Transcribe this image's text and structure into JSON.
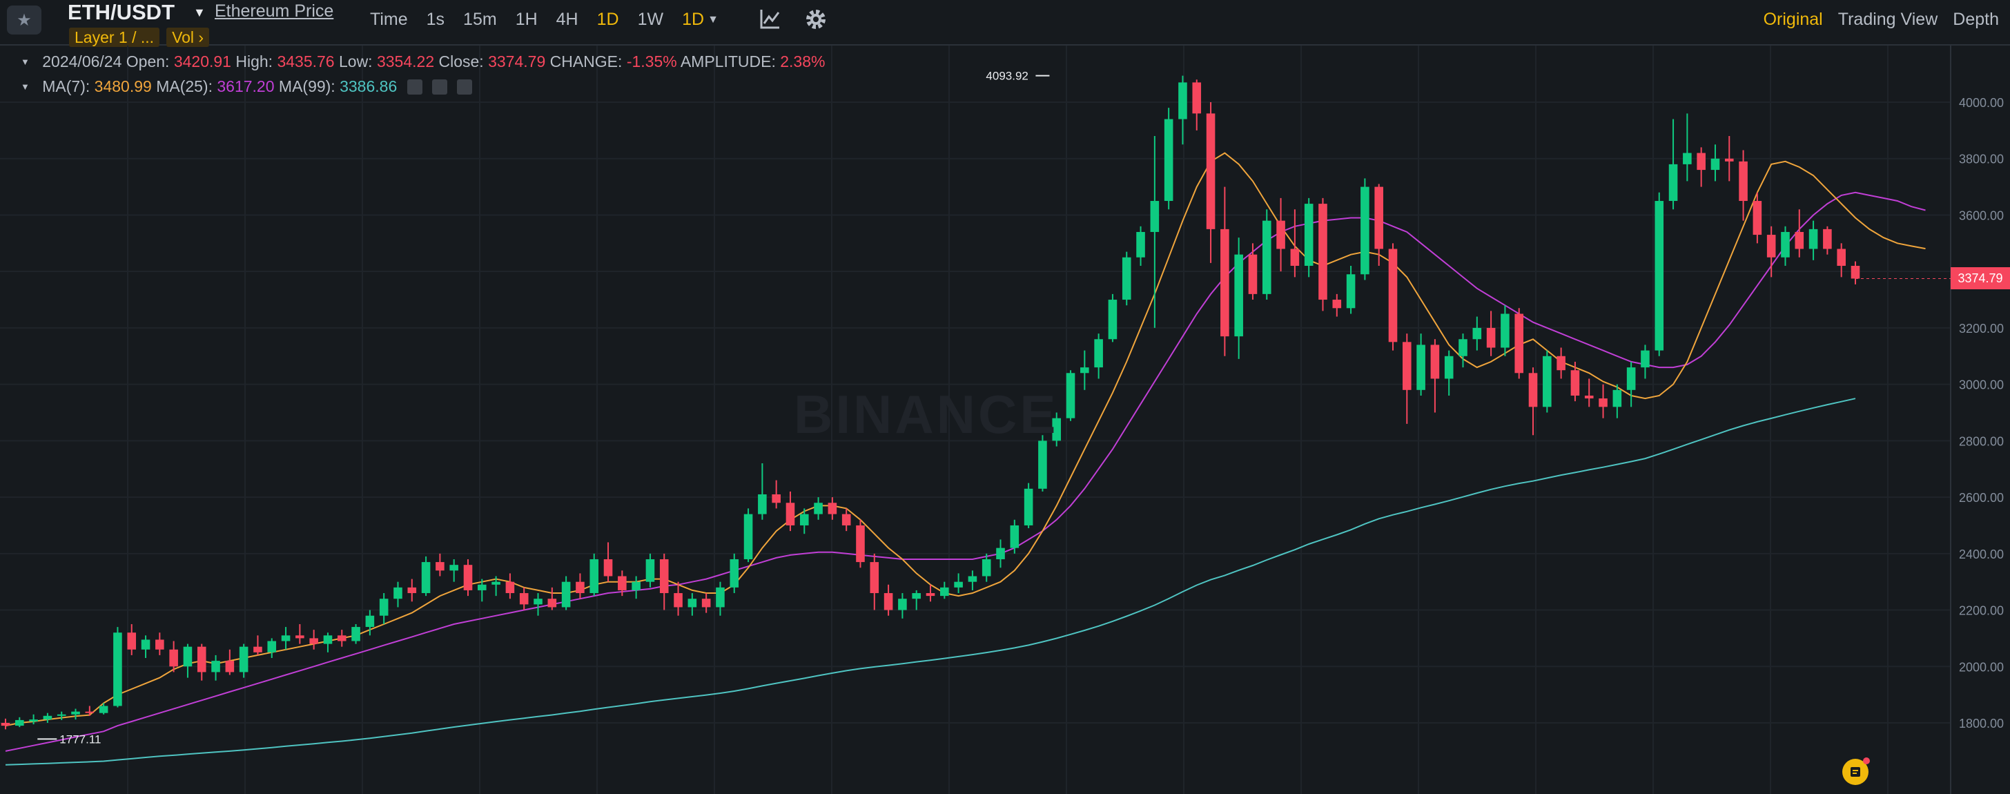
{
  "toolbar": {
    "symbol": "ETH/USDT",
    "price_link": "Ethereum Price",
    "tags": [
      "Layer 1 / ...",
      "Vol  ›"
    ],
    "intervals": [
      {
        "label": "Time",
        "active": false
      },
      {
        "label": "1s",
        "active": false
      },
      {
        "label": "15m",
        "active": false
      },
      {
        "label": "1H",
        "active": false
      },
      {
        "label": "4H",
        "active": false
      },
      {
        "label": "1D",
        "active": true
      },
      {
        "label": "1W",
        "active": false
      }
    ],
    "interval_dropdown": "1D",
    "views": [
      {
        "label": "Original",
        "active": true
      },
      {
        "label": "Trading View",
        "active": false
      },
      {
        "label": "Depth",
        "active": false
      }
    ]
  },
  "ohlc": {
    "date": "2024/06/24",
    "open_label": "Open:",
    "open": "3420.91",
    "high_label": "High:",
    "high": "3435.76",
    "low_label": "Low:",
    "low": "3354.22",
    "close_label": "Close:",
    "close": "3374.79",
    "change_label": "CHANGE:",
    "change": "-1.35%",
    "amplitude_label": "AMPLITUDE:",
    "amplitude": "2.38%"
  },
  "ma": {
    "ma7_label": "MA(7):",
    "ma7": "3480.99",
    "ma25_label": "MA(25):",
    "ma25": "3617.20",
    "ma99_label": "MA(99):",
    "ma99": "3386.86"
  },
  "watermark": "BINANCE",
  "current_price": "3374.79",
  "colors": {
    "up": "#0ecb81",
    "down": "#f6465d",
    "ma7": "#f0a53c",
    "ma25": "#c13fd6",
    "ma99": "#4fc4c2",
    "accent": "#f0b90b"
  },
  "chart_data": {
    "type": "candlestick",
    "yaxis_ticks": [
      1800,
      2000,
      2200,
      2400,
      2600,
      2800,
      3000,
      3200,
      3400,
      3600,
      3800,
      4000
    ],
    "ylim": [
      1660,
      4180
    ],
    "annotations": [
      {
        "label": "4093.92",
        "value": 4093.92,
        "index": 74
      },
      {
        "label": "1777.11",
        "value": 1777.11,
        "index": 1
      }
    ],
    "candles": [
      [
        1800,
        1815,
        1777.11,
        1790
      ],
      [
        1790,
        1820,
        1785,
        1810
      ],
      [
        1805,
        1830,
        1795,
        1812
      ],
      [
        1812,
        1835,
        1800,
        1825
      ],
      [
        1825,
        1840,
        1810,
        1830
      ],
      [
        1830,
        1850,
        1812,
        1840
      ],
      [
        1840,
        1860,
        1825,
        1835
      ],
      [
        1835,
        1870,
        1830,
        1860
      ],
      [
        1860,
        2140,
        1855,
        2120
      ],
      [
        2120,
        2150,
        2040,
        2060
      ],
      [
        2060,
        2110,
        2030,
        2095
      ],
      [
        2095,
        2120,
        2040,
        2060
      ],
      [
        2060,
        2090,
        1980,
        2000
      ],
      [
        2000,
        2080,
        1960,
        2070
      ],
      [
        2070,
        2080,
        1950,
        1980
      ],
      [
        1980,
        2040,
        1950,
        2020
      ],
      [
        2020,
        2060,
        1970,
        1980
      ],
      [
        1980,
        2080,
        1960,
        2070
      ],
      [
        2070,
        2110,
        2040,
        2050
      ],
      [
        2050,
        2100,
        2030,
        2090
      ],
      [
        2090,
        2140,
        2060,
        2110
      ],
      [
        2110,
        2150,
        2080,
        2100
      ],
      [
        2100,
        2130,
        2060,
        2080
      ],
      [
        2080,
        2120,
        2050,
        2110
      ],
      [
        2110,
        2130,
        2070,
        2090
      ],
      [
        2090,
        2150,
        2080,
        2140
      ],
      [
        2140,
        2200,
        2110,
        2180
      ],
      [
        2180,
        2260,
        2150,
        2240
      ],
      [
        2240,
        2300,
        2210,
        2280
      ],
      [
        2280,
        2310,
        2230,
        2260
      ],
      [
        2260,
        2390,
        2250,
        2370
      ],
      [
        2370,
        2400,
        2320,
        2340
      ],
      [
        2340,
        2380,
        2300,
        2360
      ],
      [
        2360,
        2380,
        2250,
        2270
      ],
      [
        2270,
        2310,
        2230,
        2290
      ],
      [
        2290,
        2320,
        2250,
        2300
      ],
      [
        2300,
        2330,
        2240,
        2260
      ],
      [
        2260,
        2280,
        2200,
        2220
      ],
      [
        2220,
        2260,
        2180,
        2240
      ],
      [
        2240,
        2280,
        2200,
        2210
      ],
      [
        2210,
        2320,
        2200,
        2300
      ],
      [
        2300,
        2330,
        2240,
        2260
      ],
      [
        2260,
        2400,
        2250,
        2380
      ],
      [
        2380,
        2440,
        2300,
        2320
      ],
      [
        2320,
        2340,
        2250,
        2270
      ],
      [
        2270,
        2320,
        2240,
        2300
      ],
      [
        2300,
        2400,
        2280,
        2380
      ],
      [
        2380,
        2400,
        2200,
        2260
      ],
      [
        2260,
        2300,
        2180,
        2210
      ],
      [
        2210,
        2260,
        2180,
        2240
      ],
      [
        2240,
        2260,
        2190,
        2210
      ],
      [
        2210,
        2300,
        2180,
        2280
      ],
      [
        2280,
        2400,
        2260,
        2380
      ],
      [
        2380,
        2560,
        2370,
        2540
      ],
      [
        2540,
        2720,
        2520,
        2610
      ],
      [
        2610,
        2660,
        2560,
        2580
      ],
      [
        2580,
        2620,
        2480,
        2500
      ],
      [
        2500,
        2560,
        2470,
        2540
      ],
      [
        2540,
        2600,
        2520,
        2580
      ],
      [
        2580,
        2600,
        2520,
        2540
      ],
      [
        2540,
        2560,
        2480,
        2500
      ],
      [
        2500,
        2520,
        2350,
        2370
      ],
      [
        2370,
        2400,
        2200,
        2260
      ],
      [
        2260,
        2290,
        2180,
        2200
      ],
      [
        2200,
        2260,
        2170,
        2240
      ],
      [
        2240,
        2270,
        2200,
        2260
      ],
      [
        2260,
        2290,
        2230,
        2250
      ],
      [
        2250,
        2300,
        2240,
        2280
      ],
      [
        2280,
        2330,
        2260,
        2300
      ],
      [
        2300,
        2340,
        2270,
        2320
      ],
      [
        2320,
        2400,
        2300,
        2380
      ],
      [
        2380,
        2450,
        2350,
        2420
      ],
      [
        2420,
        2520,
        2400,
        2500
      ],
      [
        2500,
        2650,
        2490,
        2630
      ],
      [
        2630,
        2820,
        2620,
        2800
      ],
      [
        2800,
        2900,
        2780,
        2880
      ],
      [
        2880,
        3050,
        2870,
        3040
      ],
      [
        3040,
        3120,
        2980,
        3060
      ],
      [
        3060,
        3180,
        3020,
        3160
      ],
      [
        3160,
        3320,
        3150,
        3300
      ],
      [
        3300,
        3470,
        3280,
        3450
      ],
      [
        3450,
        3560,
        3420,
        3540
      ],
      [
        3540,
        3880,
        3200,
        3650
      ],
      [
        3650,
        3980,
        3620,
        3940
      ],
      [
        3940,
        4093.92,
        3850,
        4070
      ],
      [
        4070,
        4080,
        3900,
        3960
      ],
      [
        3960,
        4000,
        3430,
        3550
      ],
      [
        3550,
        3700,
        3100,
        3170
      ],
      [
        3170,
        3520,
        3090,
        3460
      ],
      [
        3460,
        3500,
        3300,
        3320
      ],
      [
        3320,
        3620,
        3300,
        3580
      ],
      [
        3580,
        3660,
        3400,
        3480
      ],
      [
        3480,
        3620,
        3380,
        3420
      ],
      [
        3420,
        3660,
        3380,
        3640
      ],
      [
        3640,
        3660,
        3260,
        3300
      ],
      [
        3300,
        3320,
        3240,
        3270
      ],
      [
        3270,
        3420,
        3250,
        3390
      ],
      [
        3390,
        3730,
        3370,
        3700
      ],
      [
        3700,
        3710,
        3420,
        3480
      ],
      [
        3480,
        3500,
        3120,
        3150
      ],
      [
        3150,
        3180,
        2860,
        2980
      ],
      [
        2980,
        3180,
        2960,
        3140
      ],
      [
        3140,
        3160,
        2900,
        3020
      ],
      [
        3020,
        3120,
        2960,
        3100
      ],
      [
        3100,
        3180,
        3060,
        3160
      ],
      [
        3160,
        3240,
        3120,
        3200
      ],
      [
        3200,
        3260,
        3100,
        3130
      ],
      [
        3130,
        3280,
        3100,
        3250
      ],
      [
        3250,
        3270,
        3020,
        3040
      ],
      [
        3040,
        3060,
        2820,
        2920
      ],
      [
        2920,
        3120,
        2900,
        3100
      ],
      [
        3100,
        3130,
        3020,
        3050
      ],
      [
        3050,
        3080,
        2940,
        2960
      ],
      [
        2960,
        3020,
        2920,
        2950
      ],
      [
        2950,
        3000,
        2880,
        2920
      ],
      [
        2920,
        3000,
        2880,
        2980
      ],
      [
        2980,
        3080,
        2920,
        3060
      ],
      [
        3060,
        3140,
        3020,
        3120
      ],
      [
        3120,
        3680,
        3100,
        3650
      ],
      [
        3650,
        3940,
        3620,
        3780
      ],
      [
        3780,
        3960,
        3720,
        3820
      ],
      [
        3820,
        3840,
        3700,
        3760
      ],
      [
        3760,
        3850,
        3720,
        3800
      ],
      [
        3800,
        3880,
        3720,
        3790
      ],
      [
        3790,
        3830,
        3580,
        3650
      ],
      [
        3650,
        3680,
        3500,
        3530
      ],
      [
        3530,
        3560,
        3380,
        3450
      ],
      [
        3450,
        3560,
        3420,
        3540
      ],
      [
        3540,
        3620,
        3450,
        3480
      ],
      [
        3480,
        3580,
        3440,
        3550
      ],
      [
        3550,
        3560,
        3460,
        3480
      ],
      [
        3480,
        3500,
        3380,
        3420
      ],
      [
        3420,
        3435.76,
        3354.22,
        3374.79
      ]
    ],
    "ma7": [
      1790,
      1800,
      1805,
      1812,
      1818,
      1824,
      1828,
      1870,
      1900,
      1920,
      1940,
      1960,
      1990,
      2010,
      2020,
      2010,
      2020,
      2030,
      2040,
      2050,
      2060,
      2070,
      2080,
      2090,
      2100,
      2110,
      2130,
      2150,
      2170,
      2190,
      2220,
      2250,
      2270,
      2290,
      2300,
      2310,
      2300,
      2280,
      2270,
      2260,
      2260,
      2270,
      2290,
      2300,
      2300,
      2300,
      2310,
      2310,
      2290,
      2270,
      2260,
      2260,
      2290,
      2350,
      2420,
      2480,
      2520,
      2550,
      2570,
      2570,
      2560,
      2520,
      2470,
      2420,
      2380,
      2330,
      2290,
      2260,
      2250,
      2260,
      2280,
      2300,
      2340,
      2400,
      2480,
      2570,
      2670,
      2770,
      2870,
      2970,
      3080,
      3200,
      3320,
      3450,
      3580,
      3700,
      3790,
      3820,
      3780,
      3720,
      3640,
      3560,
      3490,
      3440,
      3420,
      3440,
      3460,
      3470,
      3460,
      3430,
      3380,
      3300,
      3220,
      3140,
      3090,
      3060,
      3080,
      3110,
      3140,
      3160,
      3120,
      3080,
      3060,
      3040,
      3010,
      2990,
      2960,
      2950,
      2960,
      3000,
      3080,
      3200,
      3320,
      3440,
      3560,
      3680,
      3780,
      3790,
      3770,
      3740,
      3690,
      3640,
      3590,
      3550,
      3520,
      3500,
      3490,
      3481
    ],
    "ma25": [
      1700,
      1710,
      1720,
      1730,
      1740,
      1750,
      1760,
      1770,
      1790,
      1805,
      1820,
      1835,
      1850,
      1865,
      1880,
      1895,
      1910,
      1925,
      1940,
      1955,
      1970,
      1985,
      2000,
      2015,
      2030,
      2045,
      2060,
      2075,
      2090,
      2105,
      2120,
      2135,
      2150,
      2160,
      2170,
      2180,
      2190,
      2200,
      2210,
      2220,
      2230,
      2240,
      2250,
      2260,
      2265,
      2270,
      2275,
      2285,
      2290,
      2300,
      2310,
      2325,
      2340,
      2355,
      2370,
      2385,
      2395,
      2400,
      2405,
      2405,
      2400,
      2395,
      2390,
      2385,
      2380,
      2380,
      2380,
      2380,
      2380,
      2380,
      2390,
      2400,
      2420,
      2450,
      2480,
      2520,
      2570,
      2630,
      2700,
      2770,
      2850,
      2930,
      3010,
      3090,
      3170,
      3250,
      3320,
      3380,
      3430,
      3470,
      3510,
      3540,
      3560,
      3570,
      3580,
      3585,
      3590,
      3590,
      3580,
      3560,
      3540,
      3500,
      3460,
      3420,
      3380,
      3340,
      3310,
      3280,
      3250,
      3220,
      3200,
      3180,
      3160,
      3140,
      3120,
      3100,
      3080,
      3070,
      3060,
      3060,
      3070,
      3100,
      3150,
      3210,
      3280,
      3350,
      3420,
      3490,
      3550,
      3600,
      3640,
      3670,
      3680,
      3670,
      3660,
      3650,
      3630,
      3617
    ]
  }
}
